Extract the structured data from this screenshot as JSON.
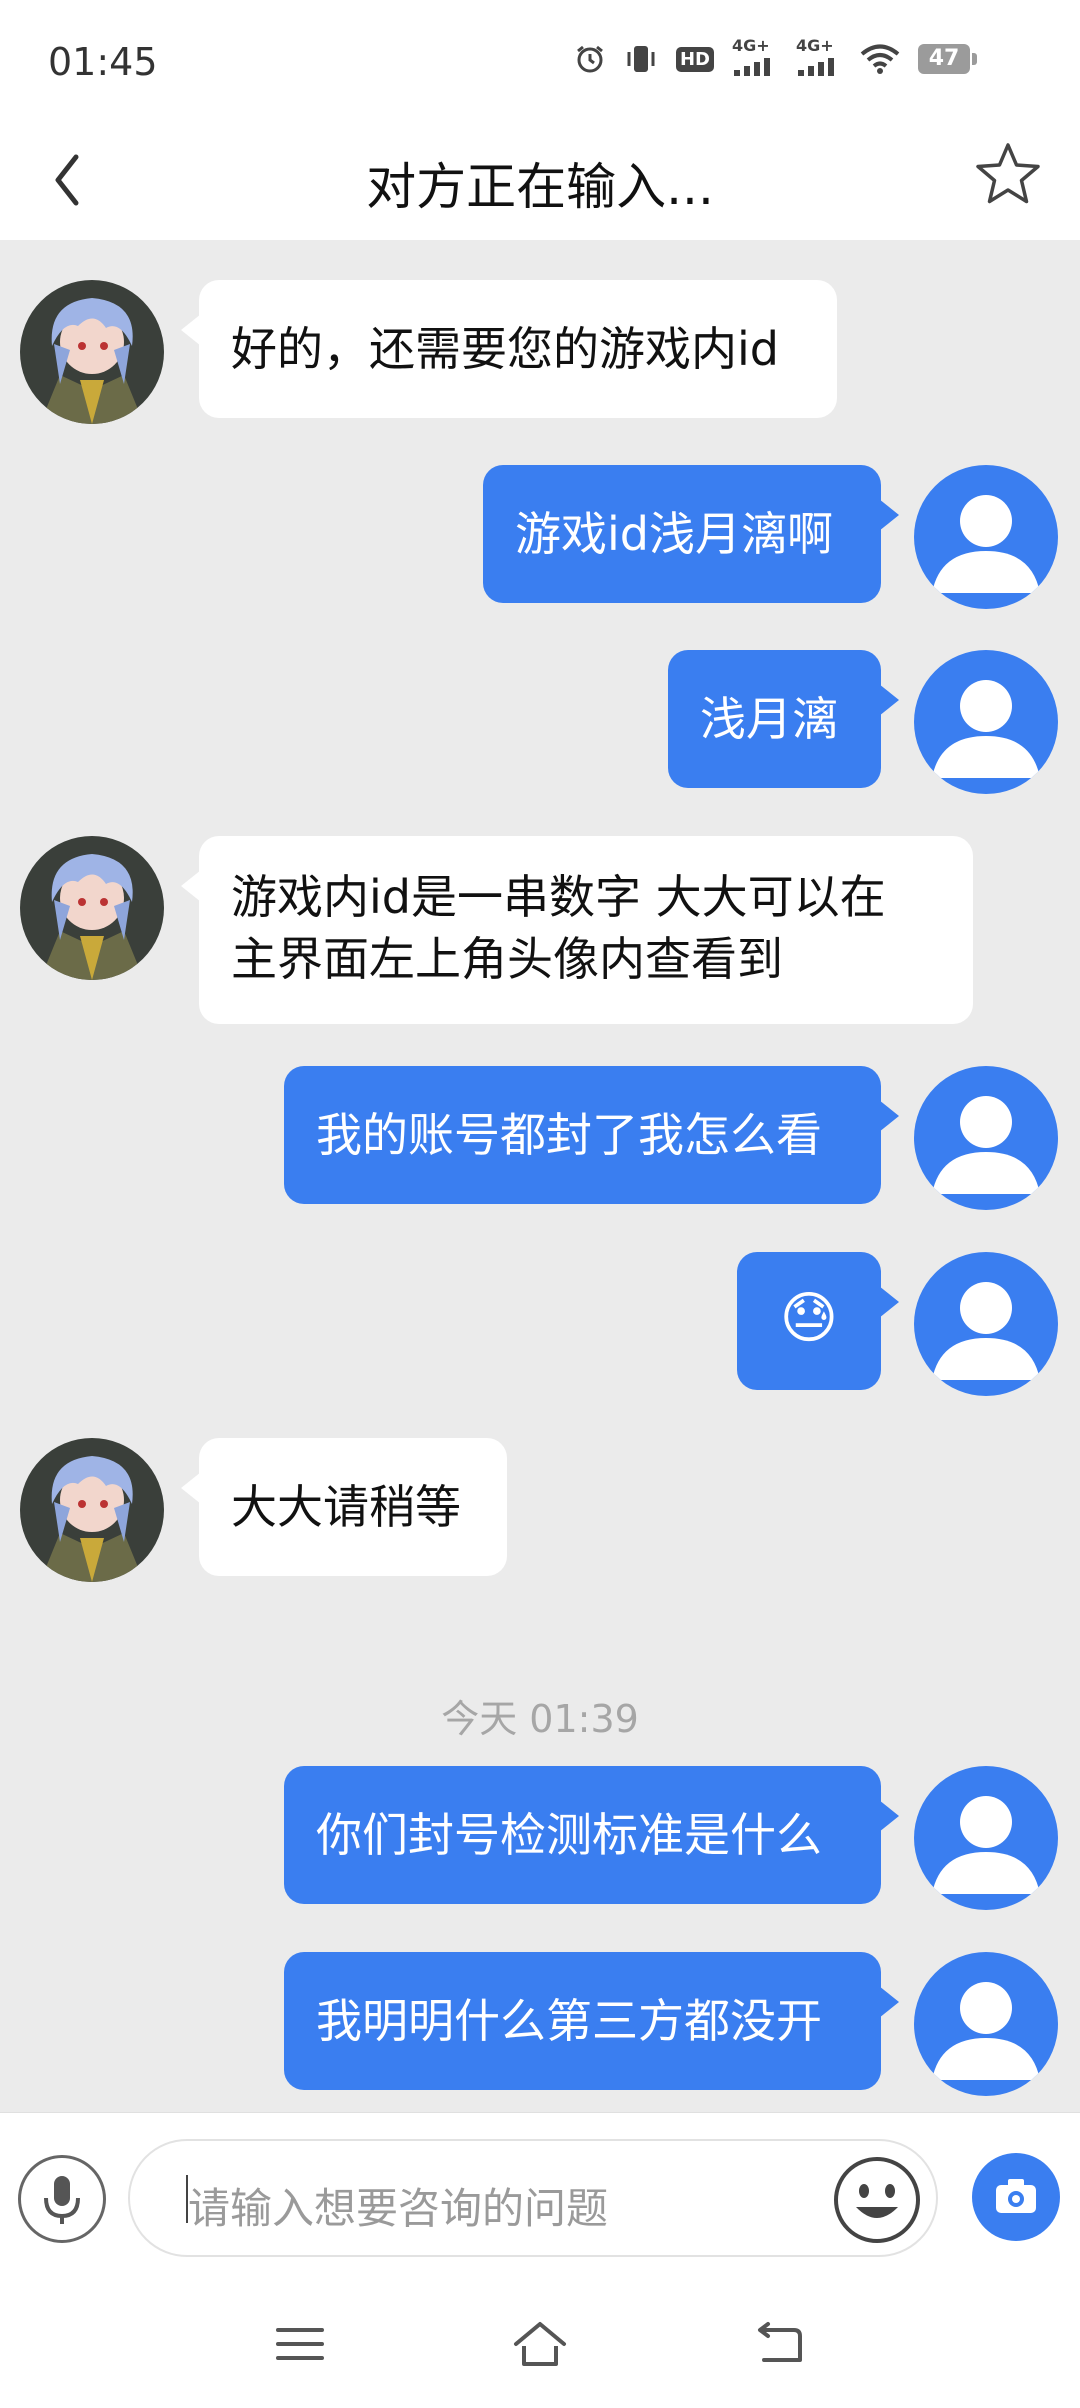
{
  "status_bar": {
    "time": "01:45",
    "battery": "47",
    "network_1": "4G+",
    "network_2": "4G+",
    "hd_label": "HD"
  },
  "header": {
    "title": "对方正在输入..."
  },
  "messages": [
    {
      "sender": "agent",
      "text": "好的，还需要您的游戏内id"
    },
    {
      "sender": "user",
      "text": "游戏id浅月漓啊"
    },
    {
      "sender": "user",
      "text": "浅月漓"
    },
    {
      "sender": "agent",
      "lines": [
        "游戏内id是一串数字 大大可以在",
        "主界面左上角头像内查看到"
      ]
    },
    {
      "sender": "user",
      "text": "我的账号都封了我怎么看"
    },
    {
      "sender": "user",
      "text": "😓"
    },
    {
      "sender": "agent",
      "text": "大大请稍等"
    },
    {
      "sender": "user",
      "text": "你们封号检测标准是什么"
    },
    {
      "sender": "user",
      "text": "我明明什么第三方都没开"
    }
  ],
  "timestamp": "今天 01:39",
  "input": {
    "placeholder": "请输入想要咨询的问题"
  },
  "colors": {
    "accent": "#3a7ef0",
    "chat_background": "#ebebeb",
    "incoming_bubble": "#ffffff"
  },
  "icons": {
    "back": "chevron-left-icon",
    "favorite": "star-icon",
    "voice": "microphone-icon",
    "emoji": "smiley-icon",
    "camera": "camera-icon",
    "nav_menu": "menu-icon",
    "nav_home": "home-icon",
    "nav_back": "back-arrow-icon"
  }
}
